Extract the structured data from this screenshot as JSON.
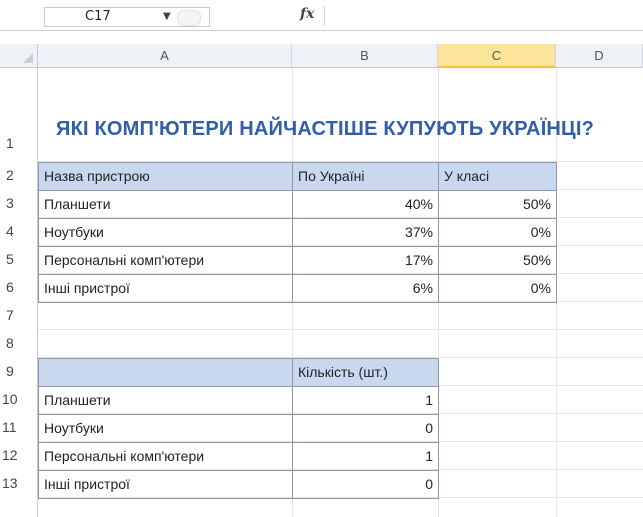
{
  "name_box": {
    "value": "C17"
  },
  "formula_bar": {
    "fx_label": "fx",
    "value": ""
  },
  "column_headers": [
    "A",
    "B",
    "C",
    "D"
  ],
  "selected_column": "C",
  "row_numbers": [
    "1",
    "2",
    "3",
    "4",
    "5",
    "6",
    "7",
    "8",
    "9",
    "10",
    "11",
    "12",
    "13"
  ],
  "title": "ЯКІ КОМП'ЮТЕРИ НАЙЧАСТІШЕ КУПУЮТЬ УКРАЇНЦІ?",
  "table1": {
    "headers": [
      "Назва пристрою",
      "По Україні",
      "У класі"
    ],
    "rows": [
      [
        "Планшети",
        "40%",
        "50%"
      ],
      [
        "Ноутбуки",
        "37%",
        "0%"
      ],
      [
        "Персональні комп'ютери",
        "17%",
        "50%"
      ],
      [
        "Інші пристрої",
        "6%",
        "0%"
      ]
    ]
  },
  "table2": {
    "headers": [
      "",
      "Кількість (шт.)"
    ],
    "rows": [
      [
        "Планшети",
        "1"
      ],
      [
        "Ноутбуки",
        "0"
      ],
      [
        "Персональні комп'ютери",
        "1"
      ],
      [
        "Інші пристрої",
        "0"
      ]
    ]
  },
  "colors": {
    "title": "#2f5fa8",
    "header_fill": "#c9d8ef",
    "selected_column": "#fbe59a"
  }
}
